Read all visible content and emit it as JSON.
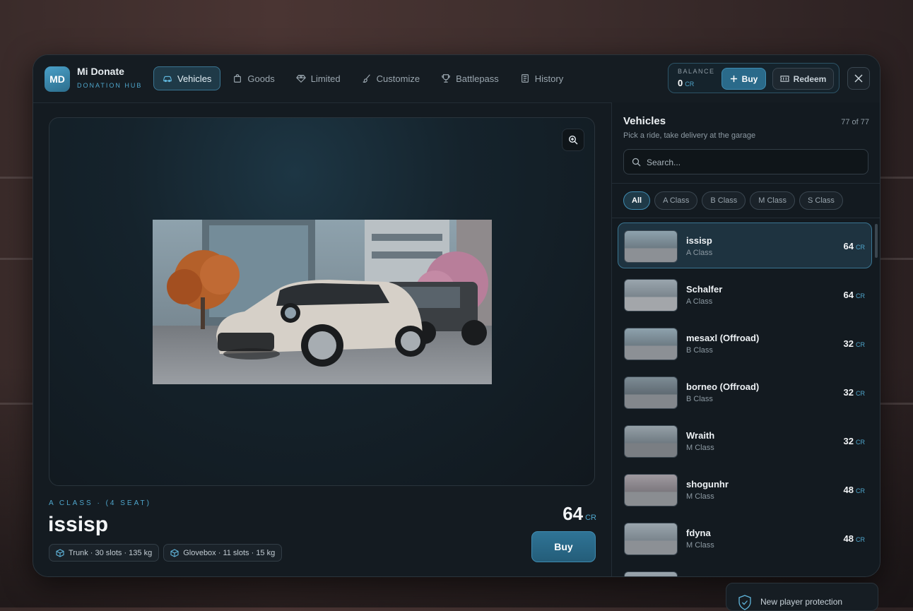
{
  "brand": {
    "initials": "MD",
    "name": "Mi Donate",
    "subtitle": "DONATION HUB"
  },
  "tabs": [
    {
      "label": "Vehicles",
      "icon": "car-icon",
      "active": true
    },
    {
      "label": "Goods",
      "icon": "bag-icon"
    },
    {
      "label": "Limited",
      "icon": "diamond-icon"
    },
    {
      "label": "Customize",
      "icon": "brush-icon"
    },
    {
      "label": "Battlepass",
      "icon": "trophy-icon"
    },
    {
      "label": "History",
      "icon": "document-icon"
    }
  ],
  "balance": {
    "label": "BALANCE",
    "value": "0",
    "unit": "CR",
    "buy_label": "Buy",
    "redeem_label": "Redeem"
  },
  "selected": {
    "class_label": "A CLASS · (4 SEAT)",
    "name": "issisp",
    "price": "64",
    "unit": "CR",
    "buy_label": "Buy",
    "specs": [
      "Trunk · 30 slots · 135 kg",
      "Glovebox · 11 slots · 15 kg"
    ]
  },
  "sidebar": {
    "title": "Vehicles",
    "subtitle": "Pick a ride, take delivery at the garage",
    "count": "77 of 77",
    "search_placeholder": "Search...",
    "filters": [
      "All",
      "A Class",
      "B Class",
      "M Class",
      "S Class"
    ],
    "items": [
      {
        "name": "issisp",
        "class": "A Class",
        "price": "64",
        "unit": "CR"
      },
      {
        "name": "Schalfer",
        "class": "A Class",
        "price": "64",
        "unit": "CR"
      },
      {
        "name": "mesaxl (Offroad)",
        "class": "B Class",
        "price": "32",
        "unit": "CR"
      },
      {
        "name": "borneo (Offroad)",
        "class": "B Class",
        "price": "32",
        "unit": "CR"
      },
      {
        "name": "Wraith",
        "class": "M Class",
        "price": "32",
        "unit": "CR"
      },
      {
        "name": "shogunhr",
        "class": "M Class",
        "price": "48",
        "unit": "CR"
      },
      {
        "name": "fdyna",
        "class": "M Class",
        "price": "48",
        "unit": "CR"
      }
    ]
  },
  "toast": {
    "text": "New player protection"
  },
  "colors": {
    "accent": "#4fa6cc",
    "accent_dark": "#2a6a8a",
    "panel": "#141b21"
  }
}
